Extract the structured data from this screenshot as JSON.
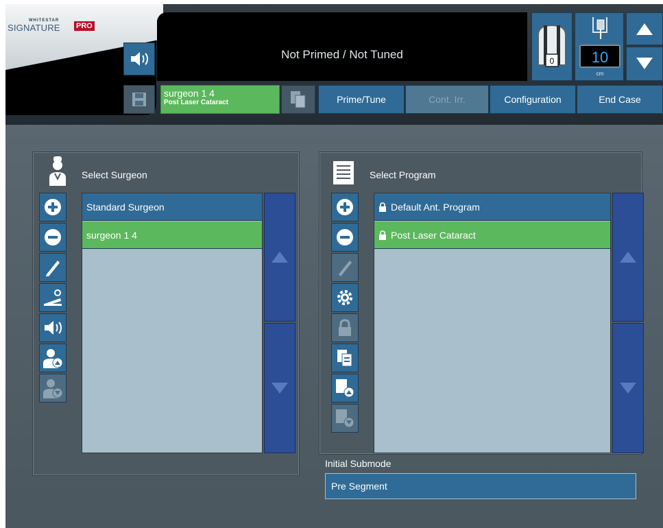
{
  "logo": {
    "small_text": "WHITESTAR",
    "main_text": "SIGNATURE",
    "badge": "PRO"
  },
  "header": {
    "status_text": "Not Primed / Not Tuned",
    "surgeon_tag": {
      "name": "surgeon 1 4",
      "program": "Post Laser Cataract"
    },
    "tabs": [
      {
        "label": "Prime/Tune",
        "enabled": true
      },
      {
        "label": "Cont. Irr.",
        "enabled": false
      },
      {
        "label": "Configuration",
        "enabled": true
      },
      {
        "label": "End Case",
        "enabled": true
      }
    ],
    "handpiece_counter": "0",
    "bottle_height": {
      "value": "10",
      "unit": "cm"
    }
  },
  "surgeon_panel": {
    "title": "Select Surgeon",
    "surgeons": [
      {
        "label": "Standard Surgeon",
        "selected": false
      },
      {
        "label": "surgeon 1 4",
        "selected": true
      }
    ],
    "side_buttons": [
      "plus-icon",
      "minus-icon",
      "pencil-icon",
      "footpedal-settings-icon",
      "speaker-icon",
      "surgeon-import-icon",
      "surgeon-export-icon"
    ]
  },
  "program_panel": {
    "title": "Select Program",
    "programs": [
      {
        "label": "Default Ant. Program",
        "locked": true,
        "selected": false
      },
      {
        "label": "Post Laser Cataract",
        "locked": true,
        "selected": true
      }
    ],
    "side_buttons": [
      "plus-icon",
      "minus-icon",
      "pencil-icon",
      "gear-icon",
      "lock-icon",
      "copy-icon",
      "program-import-icon",
      "program-export-icon"
    ]
  },
  "submode": {
    "label": "Initial Submode",
    "value": "Pre Segment"
  },
  "colors": {
    "accent_blue": "#2f6b96",
    "selected_green": "#5cb85c",
    "scroll_blue": "#2c4e96",
    "list_bg": "#a9bfcb"
  }
}
